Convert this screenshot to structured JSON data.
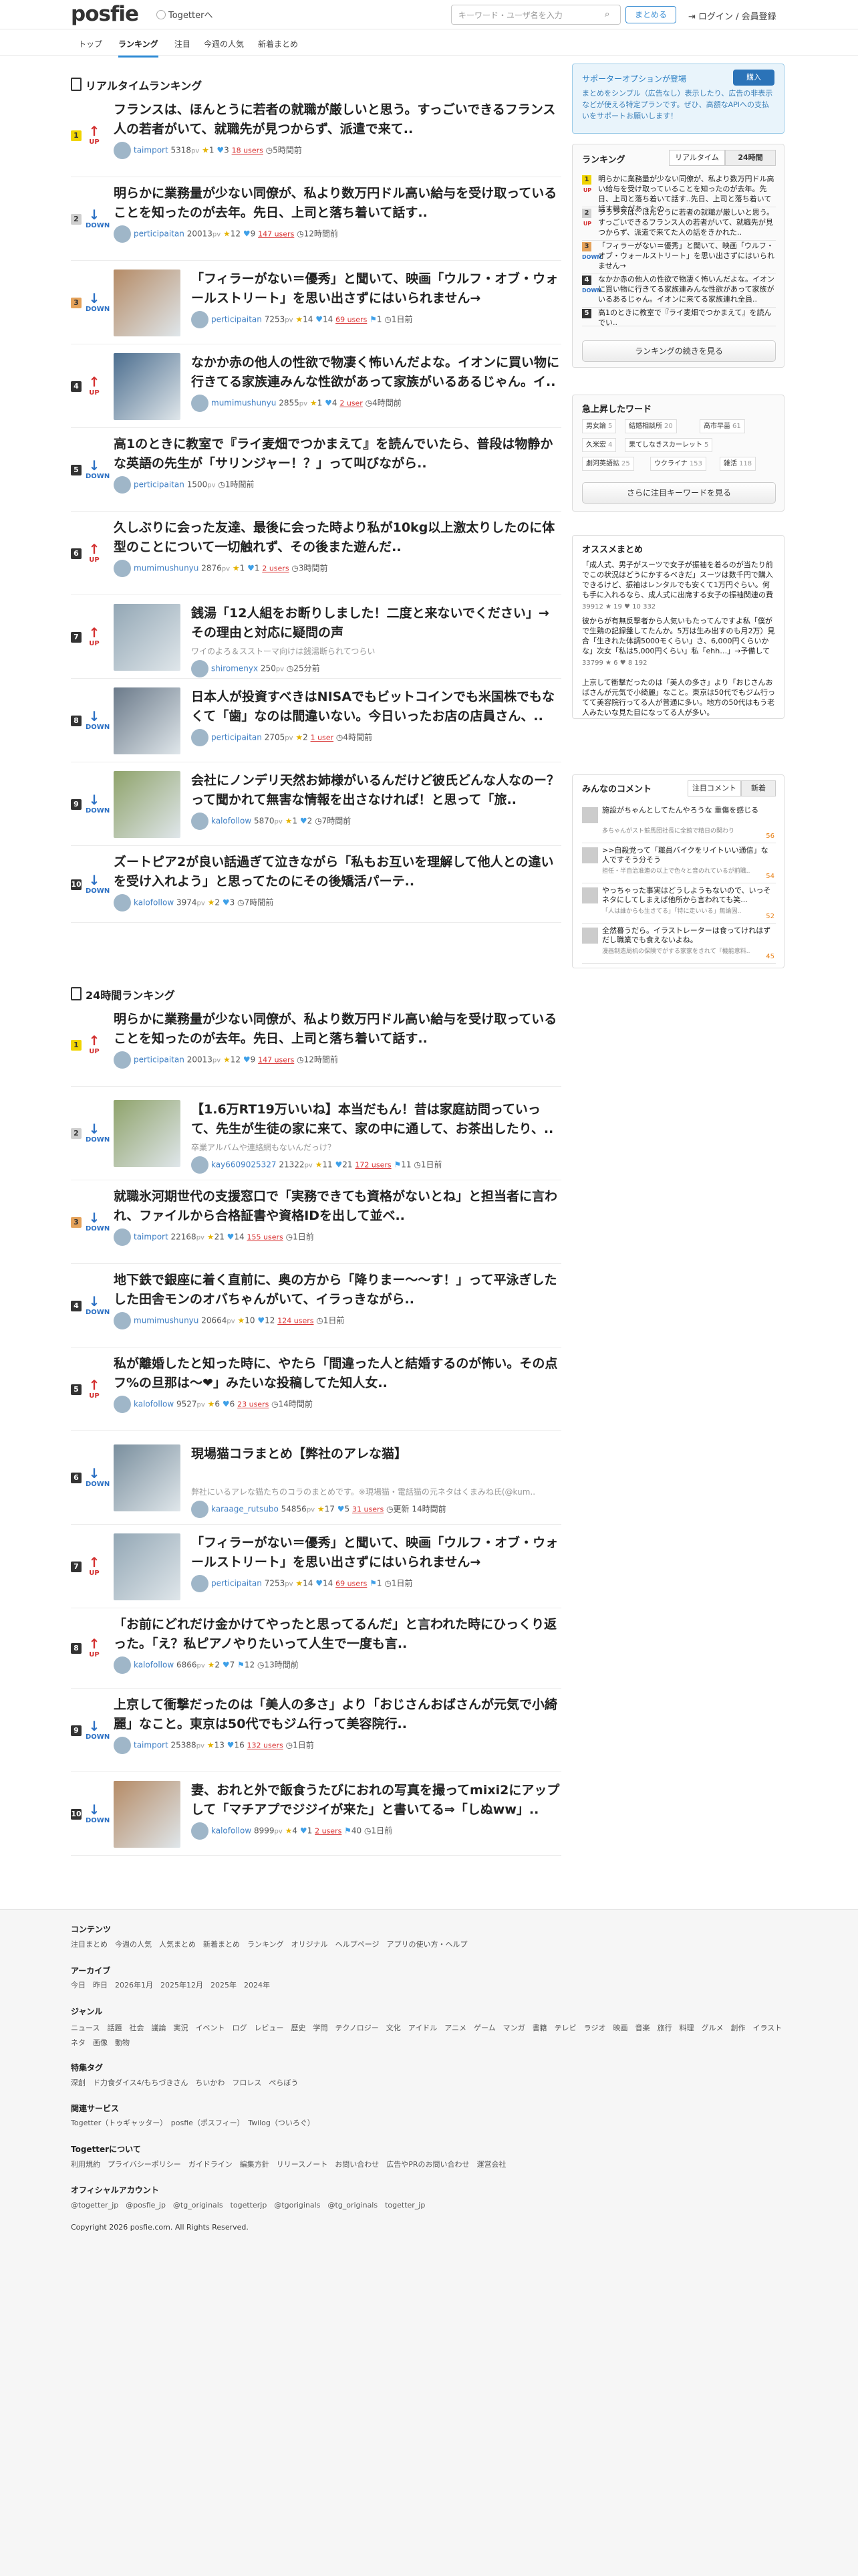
{
  "header": {
    "logo": "posfie",
    "togetter": "Togetterへ",
    "search_placeholder": "キーワード・ユーザ名を入力",
    "matome_btn": "まとめる",
    "login": "ログイン / 会員登録"
  },
  "nav": [
    "トップ",
    "ランキング",
    "注目",
    "今週の人気",
    "新着まとめ"
  ],
  "realtime": {
    "title": "リアルタイムランキング",
    "items": [
      {
        "rank": "1",
        "move": "UP",
        "title": "フランスは、ほんとうに若者の就職が厳しいと思う。すっごいできるフランス人の若者がいて、就職先が見つからず、派遣で来て..",
        "user": "taimport",
        "pts": "5318",
        "star": "1",
        "tw": "3",
        "users": "18 users",
        "time": "5時間前"
      },
      {
        "rank": "2",
        "move": "DOWN",
        "title": "明らかに業務量が少ない同僚が、私より数万円ドル高い給与を受け取っていることを知ったのが去年。先日、上司と落ち着いて話す..",
        "user": "perticipaitan",
        "pts": "20013",
        "star": "12",
        "tw": "9",
        "users": "147 users",
        "time": "12時間前"
      },
      {
        "rank": "3",
        "move": "DOWN",
        "title": "「フィラーがない＝優秀」と聞いて、映画「ウルフ・オブ・ウォールストリート」を思い出さずにはいられません→",
        "user": "perticipaitan",
        "pts": "7253",
        "star": "14",
        "tw": "14",
        "users": "69 users",
        "bk": "1",
        "time": "1日前"
      },
      {
        "rank": "4",
        "move": "UP",
        "title": "なかか赤の他人の性欲で物凄く怖いんだよな。イオンに買い物に行きてる家族連みんな性欲があって家族がいるあるじゃん。イ..",
        "user": "mumimushunyu",
        "pts": "2855",
        "star": "1",
        "tw": "4",
        "users": "2 user",
        "time": "4時間前"
      },
      {
        "rank": "5",
        "move": "DOWN",
        "title": "高1のときに教室で『ライ麦畑でつかまえて』を読んでいたら、普段は物静かな英語の先生が「サリンジャー！？」って叫びながら..",
        "user": "perticipaitan",
        "pts": "1500",
        "time": "1時間前"
      },
      {
        "rank": "6",
        "move": "UP",
        "title": "久しぶりに会った友達、最後に会った時より私が10kg以上激太りしたのに体型のことについて一切触れず、その後また遊んだ..",
        "user": "mumimushunyu",
        "pts": "2876",
        "star": "1",
        "tw": "1",
        "users": "2 users",
        "time": "3時間前"
      },
      {
        "rank": "7",
        "move": "UP",
        "title": "銭湯「12人組をお断りしました！二度と来ないでください」→その理由と対応に疑問の声",
        "sub": "ワイのよろ＆スストーマ向けは銭湯断られてつらい",
        "user": "shiromenyx",
        "pts": "250",
        "time": "25分前"
      },
      {
        "rank": "8",
        "move": "DOWN",
        "title": "日本人が投資すべきはNISAでもビットコインでも米国株でもなくて「歯」なのは間違いない。今日いったお店の店員さん、..",
        "user": "perticipaitan",
        "pts": "2705",
        "star": "2",
        "users": "1 user",
        "time": "4時間前"
      },
      {
        "rank": "9",
        "move": "DOWN",
        "title": "会社にノンデリ天然お姉様がいるんだけど彼氏どんな人なのー？って聞かれて無害な情報を出さなければ！と思って「旅..",
        "user": "kalofollow",
        "pts": "5870",
        "star": "1",
        "tw": "2",
        "time": "7時間前"
      },
      {
        "rank": "10",
        "move": "DOWN",
        "title": "ズートピア2が良い話過ぎて泣きながら「私もお互いを理解して他人との違いを受け入れよう」と思ってたのにその後矯活パーテ..",
        "user": "kalofollow",
        "pts": "3974",
        "star": "2",
        "tw": "3",
        "time": "7時間前"
      }
    ]
  },
  "daily": {
    "title": "24時間ランキング",
    "items": [
      {
        "rank": "1",
        "move": "UP",
        "title": "明らかに業務量が少ない同僚が、私より数万円ドル高い給与を受け取っていることを知ったのが去年。先日、上司と落ち着いて話す..",
        "user": "perticipaitan",
        "pts": "20013",
        "star": "12",
        "tw": "9",
        "users": "147 users",
        "time": "12時間前"
      },
      {
        "rank": "2",
        "move": "DOWN",
        "title": "【1.6万RT19万いいね】本当だもん！昔は家庭訪問っていって、先生が生徒の家に来て、家の中に通して、お茶出したり、..",
        "sub": "卒業アルバムや連絡網もないんだっけ？",
        "user": "kay6609025327",
        "pts": "21322",
        "star": "11",
        "tw": "21",
        "users": "172 users",
        "bk": "11",
        "time": "1日前"
      },
      {
        "rank": "3",
        "move": "DOWN",
        "title": "就職氷河期世代の支援窓口で「実務できても資格がないとね」と担当者に言われ、ファイルから合格証書や資格IDを出して並べ..",
        "user": "taimport",
        "pts": "22168",
        "star": "21",
        "tw": "14",
        "users": "155 users",
        "time": "1日前"
      },
      {
        "rank": "4",
        "move": "DOWN",
        "title": "地下鉄で銀座に着く直前に、奥の方から「降りまー〜〜す！」って平泳ぎしたした田舎モンのオバちゃんがいて、イラっきながら..",
        "user": "mumimushunyu",
        "pts": "20664",
        "star": "10",
        "tw": "12",
        "users": "124 users",
        "time": "1日前"
      },
      {
        "rank": "5",
        "move": "UP",
        "title": "私が離婚したと知った時に、やたら「間違った人と結婚するのが怖い。その点フ%の旦那は〜❤」みたいな投稿してた知人女..",
        "user": "kalofollow",
        "pts": "9527",
        "star": "6",
        "tw": "6",
        "users": "23 users",
        "time": "14時間前"
      },
      {
        "rank": "6",
        "move": "DOWN",
        "title": "現場猫コラまとめ【弊社のアレな猫】",
        "sub": "弊社にいるアレな猫たちのコラのまとめです。※現場猫・電話猫の元ネタはくまみね氏(@kum..",
        "user": "karaage_rutsubo",
        "pts": "54856",
        "star": "17",
        "tw": "5",
        "users": "31 users",
        "time": "更新 14時間前"
      },
      {
        "rank": "7",
        "move": "UP",
        "title": "「フィラーがない＝優秀」と聞いて、映画「ウルフ・オブ・ウォールストリート」を思い出さずにはいられません→",
        "user": "perticipaitan",
        "pts": "7253",
        "star": "14",
        "tw": "14",
        "users": "69 users",
        "bk": "1",
        "time": "1日前"
      },
      {
        "rank": "8",
        "move": "UP",
        "title": "「お前にどれだけ金かけてやったと思ってるんだ」と言われた時にひっくり返った。「え？私ピアノやりたいって人生で一度も言..",
        "user": "kalofollow",
        "pts": "6866",
        "star": "2",
        "tw": "7",
        "bk": "12",
        "time": "13時間前"
      },
      {
        "rank": "9",
        "move": "DOWN",
        "title": "上京して衝撃だったのは「美人の多さ」より「おじさんおばさんが元気で小綺麗」なこと。東京は50代でもジム行って美容院行..",
        "user": "taimport",
        "pts": "25388",
        "star": "13",
        "tw": "16",
        "users": "132 users",
        "time": "1日前"
      },
      {
        "rank": "10",
        "move": "DOWN",
        "title": "妻、おれと外で飯食うたびにおれの写真を撮ってmixi2にアップして「マチアプでジジイが来た」と書いてる⇒「しぬww」..",
        "user": "kalofollow",
        "pts": "8999",
        "star": "4",
        "tw": "1",
        "users": "2 users",
        "bk": "40",
        "time": "1日前"
      }
    ]
  },
  "sidebar": {
    "support": {
      "title": "サポーターオプションが登場",
      "btn": "購入",
      "body": "まとめをシンプル（広告なし）表示したり、広告の非表示などが使える特定プランです。ぜひ、高額なAPIへの支払いをサポートお願いします！"
    },
    "ranking": {
      "title": "ランキング",
      "tabs": [
        "リアルタイム",
        "24時間"
      ],
      "items": [
        {
          "n": "1",
          "a": "UP",
          "t": "明らかに業務量が少ない同僚が、私より数万円ドル高い給与を受け取っていることを知ったのが去年。先日、上司と落ち着いて話す..先日、上司と落ち着いて話す機会があったの.."
        },
        {
          "n": "2",
          "a": "UP",
          "t": "フランスは、ほんとうに若者の就職が厳しいと思う。すっごいできるフランス人の若者がいて、就職先が見つからず、派遣で来てた人の話をきかれた.."
        },
        {
          "n": "3",
          "a": "DOWN",
          "t": "「フィラーがない＝優秀」と聞いて、映画「ウルフ・オブ・ウォールストリート」を思い出さずにはいられません→"
        },
        {
          "n": "4",
          "a": "DOWN",
          "t": "なかか赤の他人の性欲で物凄く怖いんだよな。イオンに買い物に行きてる家族連みんな性欲があって家族がいるあるじゃん。イオンに来てる家族連れ全員.."
        },
        {
          "n": "5",
          "a": "DOWN",
          "t": "高1のときに教室で『ライ麦畑でつかまえて』を読んでい.."
        }
      ],
      "more": "ランキングの続きを見る"
    },
    "keywords": {
      "title": "急上昇したワード",
      "tags": [
        [
          "男女論",
          "5"
        ],
        [
          "結婚相談所",
          "20"
        ],
        [
          "高市早苗",
          "61"
        ],
        [
          "久米宏",
          "4"
        ],
        [
          "果てしなきスカーレット",
          "5"
        ],
        [
          "劇河英語拡",
          "25"
        ],
        [
          "ウクライナ",
          "153"
        ],
        [
          "雑活",
          "118"
        ]
      ],
      "more": "さらに注目キーワードを見る"
    },
    "recommend": {
      "title": "オススメまとめ",
      "items": [
        {
          "t": "「成人式、男子がスーツで女子が振袖を着るのが当たり前でこの状況はどうにかするべきだ」スーツは数千円で購入できるけど、振袖はレンタルでも安くて1万円ぐらい。何も手に入れるなら、成人式に出席する女子の振袖関連の費用は平均30万円指摘 という説",
          "m": "39912  ★ 19  ♥ 10  332"
        },
        {
          "t": "彼からが有無反撃者から人気いもたってんですよ私「僕がで生鶏の記録盤してたんか。5万は生み出すのも月2万）見合「生きれた体調5000モくらい」さ、6,000円くらいかな」次女「私は5,000円くらい」私「ehh…」→予備して家族旅行を構想、生活困窮者となりましたとさ…みたいなことあり",
          "m": "33799  ★ 6  ♥ 8  192"
        },
        {
          "t": "上京して衝撃だったのは「美人の多さ」より「おじさんおばさんが元気で小綺麗」なこと。東京は50代でもジム行ってて美容院行ってる人が普通に多い。地方の50代はもう老人みたいな見た目になってる人が多い。",
          "m": ""
        }
      ]
    },
    "comments": {
      "title": "みんなのコメント",
      "tabs": [
        "注目コメント",
        "新着"
      ],
      "items": [
        {
          "t": "施設がちゃんとしてたんやろうな 重傷を感じる",
          "q": "多ちゃんがスト競馬団社長に全館で精日の関わり",
          "c": "56"
        },
        {
          "t": ">>自殺党って「職員バイクをリイトいい通信」な人ですそう分そう",
          "q": "担任・半自治准連の以上で色々と音のれているが前職..",
          "c": "54"
        },
        {
          "t": "やっちゃった事実はどうしようもないので、いっそネタにしてしまえば他所から言われても笑...",
          "q": "「人は誰からも生きてる」「特に走いいる」無論固..",
          "c": "52"
        },
        {
          "t": "全然暮うだら。イラストレーターは食ってけれはずだし職業でも食えないよね。",
          "q": "漫画制造局机の保険でがする家家をきれて『機能意料..",
          "c": "45"
        }
      ]
    }
  },
  "footer": {
    "content_h": "コンテンツ",
    "content": "注目まとめ　今週の人気　人気まとめ　新着まとめ　ランキング　オリジナル　ヘルプページ　アプリの使い方・ヘルプ",
    "archive_h": "アーカイブ",
    "archive": "今日　昨日　2026年1月　2025年12月　2025年　2024年",
    "genre_h": "ジャンル",
    "genre": "ニュース　話題　社会　議論　実況　イベント　ログ　レビュー　歴史　学問　テクノロジー　文化　アイドル　アニメ　ゲーム　マンガ　書籍　テレビ　ラジオ　映画　音楽　旅行　料理　グルメ　創作　イラスト　ネタ　画像　動物",
    "tags_h": "特集タグ",
    "tags": "深創　ド力食ダイス4/もちづきさん　ちいかわ　フロレス　ぺらぼう",
    "service_h": "関連サービス",
    "service": "Togetter（トゥギャッター）　posfie（ポスフィー）　Twilog（ついろぐ）",
    "about_h": "Togetterについて",
    "about": "利用規約　プライバシーポリシー　ガイドライン　編集方針　リリースノート　お問い合わせ　広告やPRのお問い合わせ　運営会社",
    "accounts_h": "オフィシャルアカウント",
    "accounts": "@togetter_jp　@posfie_jp　@tg_originals　togetterjp　@tgoriginals　@tg_originals　togetter_jp",
    "copyright": "Copyright 2026 posfie.com. All Rights Reserved."
  }
}
